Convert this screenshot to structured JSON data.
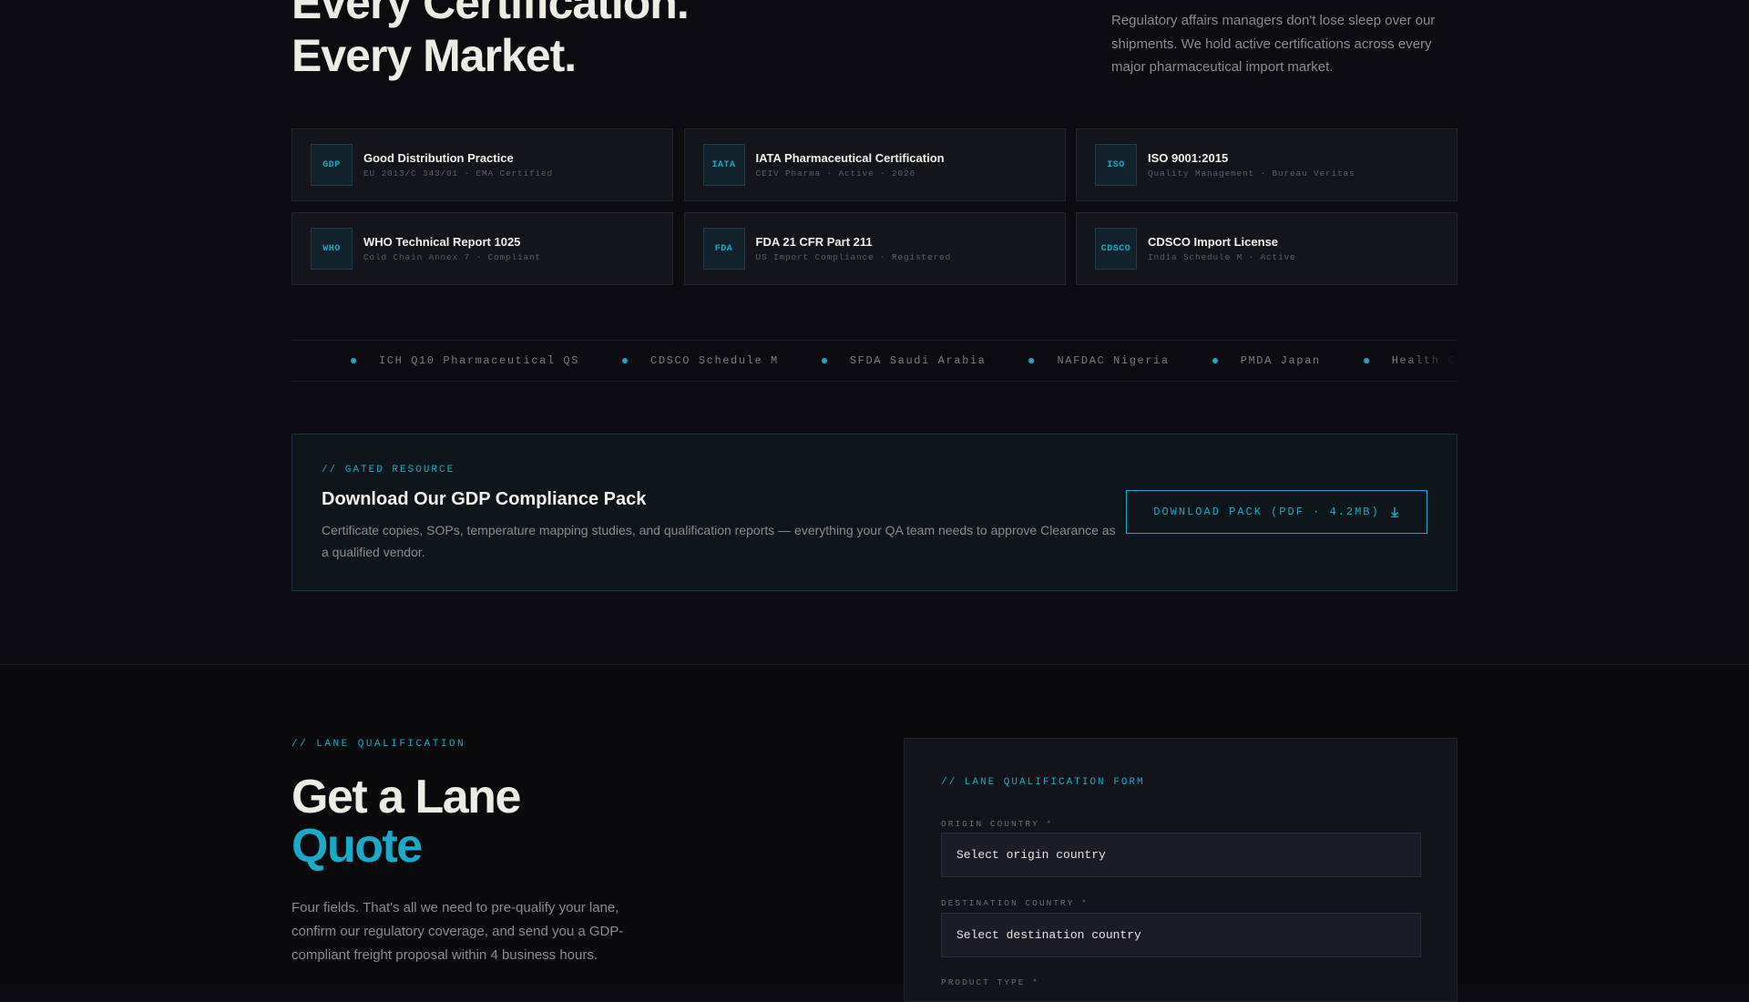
{
  "hero": {
    "title_line1": "Every Certification.",
    "title_line2": "Every Market.",
    "description": "Regulatory affairs managers don't lose sleep over our shipments. We hold active certifications across every major pharmaceutical import market."
  },
  "certifications": [
    {
      "badge": "GDP",
      "name": "Good Distribution Practice",
      "meta": "EU 2013/C 343/01 · EMA Certified"
    },
    {
      "badge": "IATA",
      "name": "IATA Pharmaceutical Certification",
      "meta": "CEIV Pharma · Active · 2026"
    },
    {
      "badge": "ISO",
      "name": "ISO 9001:2015",
      "meta": "Quality Management · Bureau Veritas"
    },
    {
      "badge": "WHO",
      "name": "WHO Technical Report 1025",
      "meta": "Cold Chain Annex 7 · Compliant"
    },
    {
      "badge": "FDA",
      "name": "FDA 21 CFR Part 211",
      "meta": "US Import Compliance · Registered"
    },
    {
      "badge": "CDSCO",
      "name": "CDSCO Import License",
      "meta": "India Schedule M · Active"
    }
  ],
  "ticker": {
    "items": [
      "ICH Q10 Pharmaceutical QS",
      "CDSCO Schedule M",
      "SFDA Saudi Arabia",
      "NAFDAC Nigeria",
      "PMDA Japan",
      "Health Canada"
    ]
  },
  "gated": {
    "eyebrow": "// GATED RESOURCE",
    "title": "Download Our GDP Compliance Pack",
    "description": "Certificate copies, SOPs, temperature mapping studies, and qualification reports — everything your QA team needs to approve Clearance as a qualified vendor.",
    "button_label": "DOWNLOAD PACK (PDF · 4.2MB)"
  },
  "lane": {
    "eyebrow": "// LANE QUALIFICATION",
    "title_line1": "Get a Lane",
    "title_line2": "Quote",
    "description": "Four fields. That's all we need to pre-qualify your lane, confirm our regulatory coverage, and send you a GDP-compliant freight proposal within 4 business hours."
  },
  "form": {
    "eyebrow": "// LANE QUALIFICATION FORM",
    "origin_label": "ORIGIN COUNTRY *",
    "origin_value": "Select origin country",
    "destination_label": "DESTINATION COUNTRY *",
    "destination_value": "Select destination country",
    "product_label": "PRODUCT TYPE *"
  },
  "colors": {
    "accent": "#1aa9c9",
    "background": "#0c0c10",
    "card": "#14141c"
  }
}
